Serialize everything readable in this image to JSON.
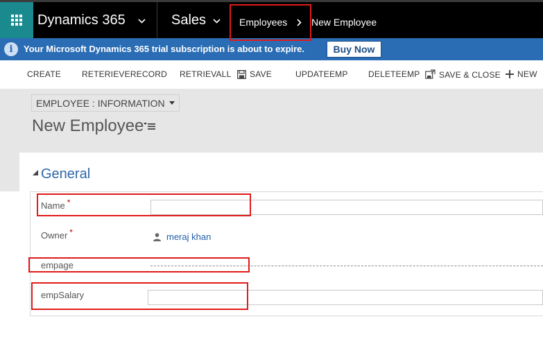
{
  "app": {
    "name": "Dynamics 365",
    "area": "Sales"
  },
  "breadcrumb": {
    "entity": "Employees",
    "record": "New Employee"
  },
  "notification": {
    "message": "Your Microsoft Dynamics 365 trial subscription is about to expire.",
    "button": "Buy Now"
  },
  "commands": {
    "create": "CREATE",
    "retrieve_record": "RETERIEVERECORD",
    "retrieve_all": "RETRIEVALL",
    "save": "SAVE",
    "update": "UPDATEEMP",
    "delete": "DELETEEMP",
    "save_close": "SAVE & CLOSE",
    "new": "NEW"
  },
  "form": {
    "selector": "EMPLOYEE : INFORMATION",
    "title": "New Employee",
    "section": "General",
    "fields": {
      "name_label": "Name",
      "name_value": "",
      "owner_label": "Owner",
      "owner_value": "meraj khan",
      "empage_label": "empage",
      "empsalary_label": "empSalary",
      "empsalary_value": ""
    },
    "required_marker": "*"
  },
  "colors": {
    "topbar": "#000000",
    "waffle": "#1a8a8f",
    "notice": "#2a6db5",
    "accent_blue": "#2f66a8",
    "highlight": "#e01a1a"
  },
  "icons": [
    "waffle-icon",
    "chevron-down-icon",
    "chevron-right-icon",
    "info-icon",
    "save-icon",
    "save-close-icon",
    "plus-icon",
    "caret-down-icon",
    "list-menu-icon",
    "person-icon",
    "triangle-icon"
  ]
}
